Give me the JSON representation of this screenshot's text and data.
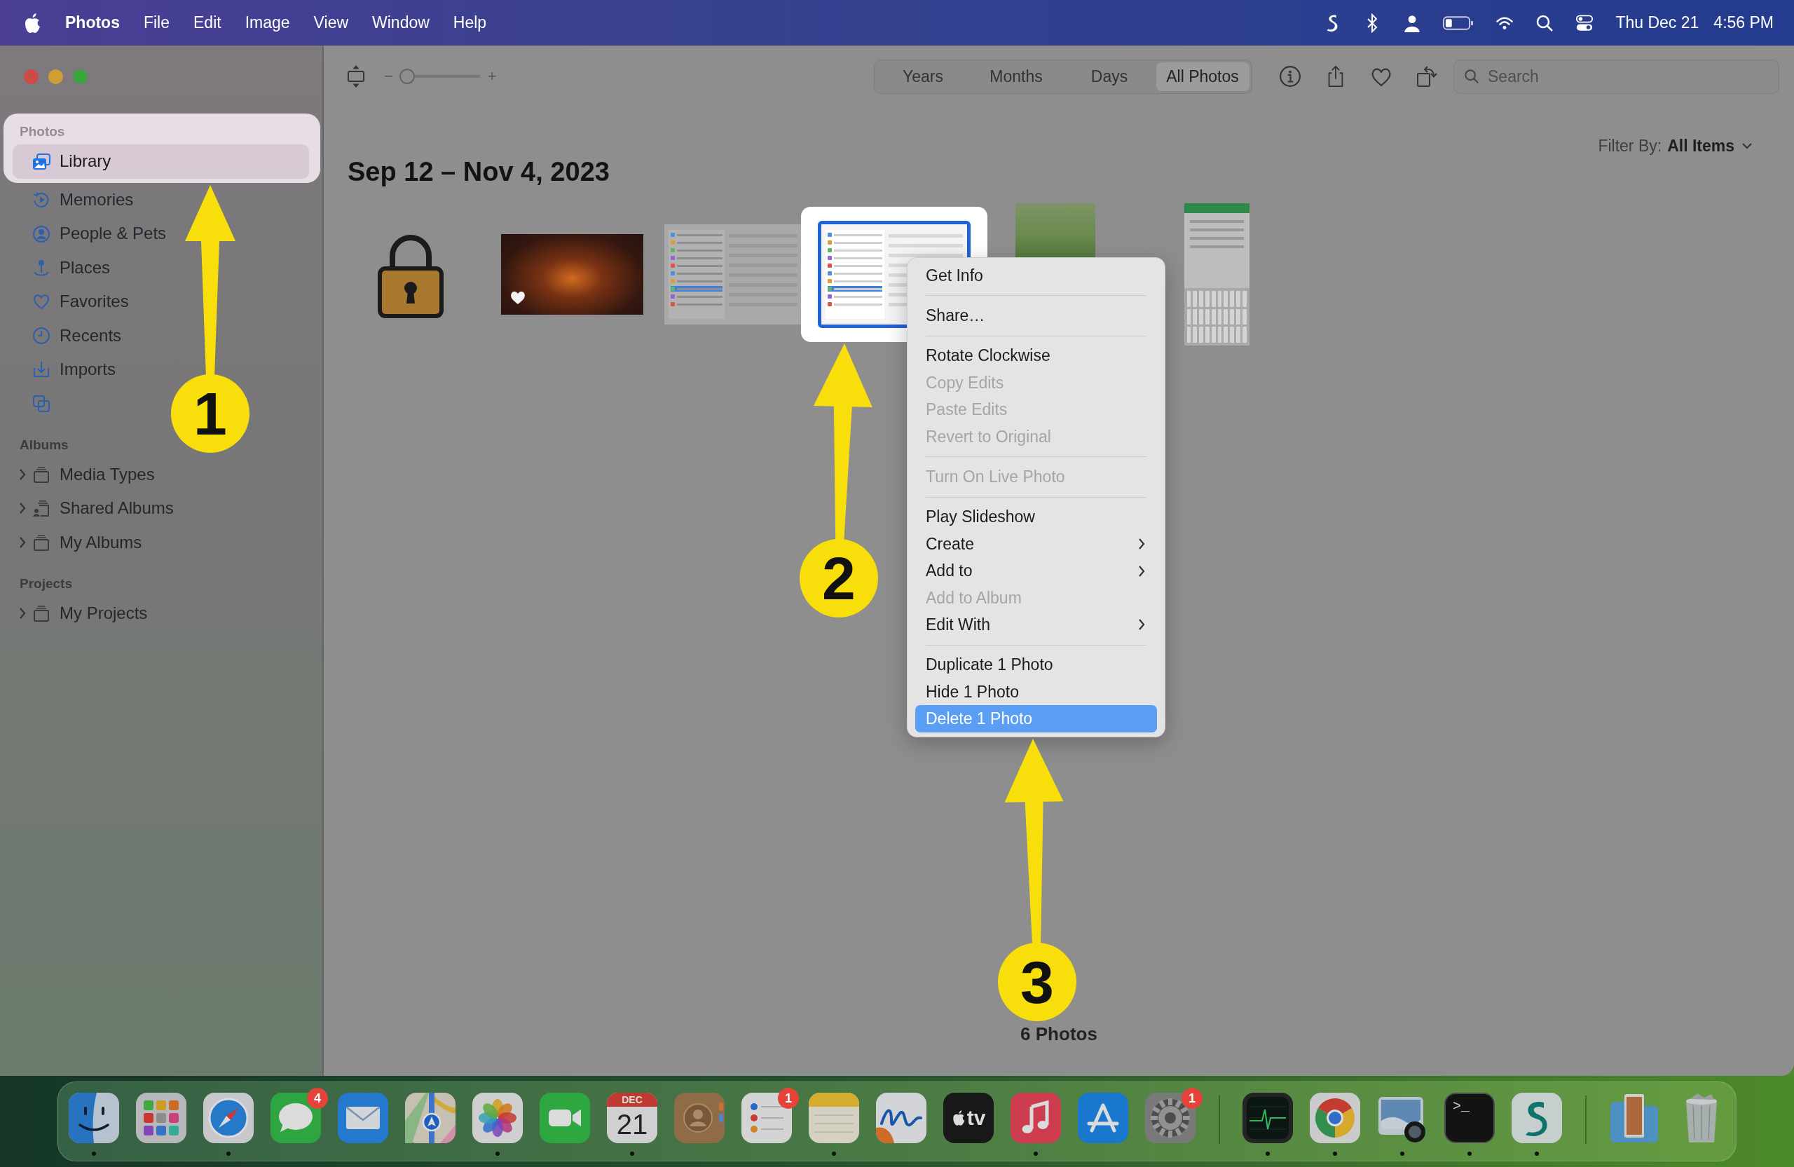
{
  "menu_bar": {
    "app_name": "Photos",
    "menus": [
      "File",
      "Edit",
      "Image",
      "View",
      "Window",
      "Help"
    ],
    "date": "Thu Dec 21",
    "time": "4:56 PM"
  },
  "sidebar": {
    "sections": [
      {
        "title": "Photos",
        "spotlight": true,
        "items": [
          {
            "label": "Library",
            "selected": true
          },
          {
            "label": "Memories",
            "selected": false
          },
          {
            "label": "People & Pets",
            "selected": false
          },
          {
            "label": "Places",
            "selected": false
          },
          {
            "label": "Favorites",
            "selected": false
          },
          {
            "label": "Recents",
            "selected": false
          },
          {
            "label": "Imports",
            "selected": false
          },
          {
            "selected": false
          }
        ]
      },
      {
        "title": "Albums",
        "spotlight": false,
        "items": [
          {
            "label": "Media Types",
            "selected": false,
            "expanded": false
          },
          {
            "label": "Shared Albums",
            "selected": false,
            "expanded": false
          },
          {
            "label": "My Albums",
            "selected": false,
            "expanded": false
          }
        ]
      },
      {
        "title": "Projects",
        "spotlight": false,
        "items": [
          {
            "label": "My Projects",
            "selected": false,
            "expanded": false
          }
        ]
      }
    ]
  },
  "toolbar": {
    "zoom": {
      "minus": "−",
      "plus": "+",
      "level": 0.1
    },
    "views": [
      {
        "label": "Years",
        "selected": false
      },
      {
        "label": "Months",
        "selected": false
      },
      {
        "label": "Days",
        "selected": false
      },
      {
        "label": "All Photos",
        "selected": true
      }
    ],
    "search": {
      "placeholder": "Search"
    }
  },
  "content": {
    "filter": {
      "label": "Filter By:",
      "value": "All Items"
    },
    "title": "Sep 12 – Nov 4, 2023",
    "photos": [
      {
        "kind": "padlock",
        "selected": false,
        "favorite": false
      },
      {
        "kind": "artwork",
        "selected": false,
        "favorite": true
      },
      {
        "kind": "screenshot",
        "selected": false,
        "favorite": false
      },
      {
        "kind": "screenshot",
        "selected": true,
        "favorite": false
      },
      {
        "kind": "photo",
        "selected": false,
        "favorite": false
      },
      {
        "kind": "phone",
        "selected": false,
        "favorite": false
      }
    ],
    "count": "6 Photos"
  },
  "context_menu": {
    "items": [
      {
        "kind": "item",
        "label": "Get Info",
        "disabled": false,
        "submenu": false,
        "selected": false
      },
      {
        "kind": "separator"
      },
      {
        "kind": "item",
        "label": "Share…",
        "disabled": false,
        "submenu": false,
        "selected": false
      },
      {
        "kind": "separator"
      },
      {
        "kind": "item",
        "label": "Rotate Clockwise",
        "disabled": false,
        "submenu": false,
        "selected": false
      },
      {
        "kind": "item",
        "label": "Copy Edits",
        "disabled": true,
        "submenu": false,
        "selected": false
      },
      {
        "kind": "item",
        "label": "Paste Edits",
        "disabled": true,
        "submenu": false,
        "selected": false
      },
      {
        "kind": "item",
        "label": "Revert to Original",
        "disabled": true,
        "submenu": false,
        "selected": false
      },
      {
        "kind": "separator"
      },
      {
        "kind": "item",
        "label": "Turn On Live Photo",
        "disabled": true,
        "submenu": false,
        "selected": false
      },
      {
        "kind": "separator"
      },
      {
        "kind": "item",
        "label": "Play Slideshow",
        "disabled": false,
        "submenu": false,
        "selected": false
      },
      {
        "kind": "item",
        "label": "Create",
        "disabled": false,
        "submenu": true,
        "selected": false
      },
      {
        "kind": "item",
        "label": "Add to",
        "disabled": false,
        "submenu": true,
        "selected": false
      },
      {
        "kind": "item",
        "label": "Add to Album",
        "disabled": true,
        "submenu": false,
        "selected": false
      },
      {
        "kind": "item",
        "label": "Edit With",
        "disabled": false,
        "submenu": true,
        "selected": false
      },
      {
        "kind": "separator"
      },
      {
        "kind": "item",
        "label": "Duplicate 1 Photo",
        "disabled": false,
        "submenu": false,
        "selected": false
      },
      {
        "kind": "item",
        "label": "Hide 1 Photo",
        "disabled": false,
        "submenu": false,
        "selected": false
      },
      {
        "kind": "item",
        "label": "Delete 1 Photo",
        "disabled": false,
        "submenu": false,
        "selected": true
      }
    ]
  },
  "callouts": [
    {
      "number": "1"
    },
    {
      "number": "2"
    },
    {
      "number": "3"
    }
  ],
  "dock": {
    "items": [
      {
        "kind": "finder",
        "running": true
      },
      {
        "kind": "launchpad",
        "running": false
      },
      {
        "kind": "safari",
        "running": true
      },
      {
        "kind": "messages",
        "running": false,
        "badge": "4"
      },
      {
        "kind": "mail",
        "running": false
      },
      {
        "kind": "maps",
        "running": false
      },
      {
        "kind": "photos",
        "running": true
      },
      {
        "kind": "facetime",
        "running": false
      },
      {
        "kind": "calendar",
        "running": true,
        "month": "DEC",
        "day": "21"
      },
      {
        "kind": "contacts",
        "running": false
      },
      {
        "kind": "reminders",
        "running": false,
        "badge": "1"
      },
      {
        "kind": "notes",
        "running": true
      },
      {
        "kind": "freeform",
        "running": false
      },
      {
        "kind": "tv",
        "running": false,
        "label": "tv"
      },
      {
        "kind": "music",
        "running": true
      },
      {
        "kind": "appstore",
        "running": false
      },
      {
        "kind": "settings",
        "running": false,
        "badge": "1"
      },
      {
        "kind": "divider"
      },
      {
        "kind": "monitor",
        "running": true
      },
      {
        "kind": "chrome",
        "running": true
      },
      {
        "kind": "preview",
        "running": true
      },
      {
        "kind": "terminal",
        "running": true,
        "label": ">_"
      },
      {
        "kind": "vpn",
        "running": true
      },
      {
        "kind": "divider"
      },
      {
        "kind": "folder",
        "running": false
      },
      {
        "kind": "trash",
        "running": false
      }
    ]
  }
}
